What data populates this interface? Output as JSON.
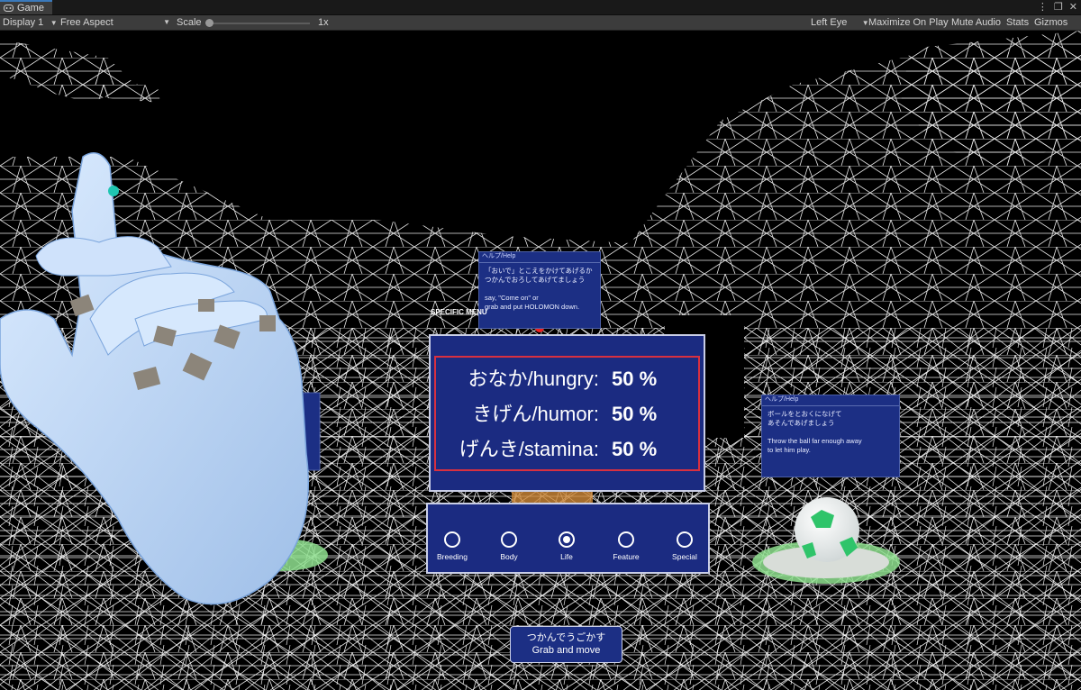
{
  "window": {
    "tab_label": "Game",
    "tab_icon": "gamepad-icon",
    "menu_icon": "kebab-menu-icon",
    "maximize_icon": "maximize-icon",
    "close_icon": "close-icon"
  },
  "toolbar": {
    "display": "Display 1",
    "aspect": "Free Aspect",
    "scale_label": "Scale",
    "scale_value": "1x",
    "eye": "Left Eye",
    "maximize_on_play": "Maximize On Play",
    "mute_audio": "Mute Audio",
    "stats": "Stats",
    "gizmos": "Gizmos"
  },
  "help_top": {
    "title": "ヘルプ/Help",
    "body": "「おいで」とこえをかけてあげるか\nつかんでおろしてあげてましょう\n\nsay, \"Come on\" or\ngrab and put HOLOMON down."
  },
  "help_right": {
    "title": "ヘルプ/Help",
    "body": "ボールをとおくになげて\nあそんであげましょう\n\nThrow the ball far enough away\nto let him play."
  },
  "menu_caption": "SPECIFIC MENU",
  "status": {
    "rows": [
      {
        "label": "おなか/hungry:",
        "value": "50 %"
      },
      {
        "label": "きげん/humor:",
        "value": "50 %"
      },
      {
        "label": "げんき/stamina:",
        "value": "50 %"
      }
    ]
  },
  "menu": {
    "items": [
      {
        "label": "Breeding",
        "selected": false
      },
      {
        "label": "Body",
        "selected": false
      },
      {
        "label": "Life",
        "selected": true
      },
      {
        "label": "Feature",
        "selected": false
      },
      {
        "label": "Special",
        "selected": false
      }
    ]
  },
  "grab": {
    "line1": "つかんでうごかす",
    "line2": "Grab and move"
  },
  "colors": {
    "panel": "#1b2b81",
    "highlight_border": "#d83040",
    "tab_accent": "#3a79bb",
    "hand": "#b8d4f4",
    "target_green": "#8fe08f",
    "ball_green": "#2fc46a"
  }
}
